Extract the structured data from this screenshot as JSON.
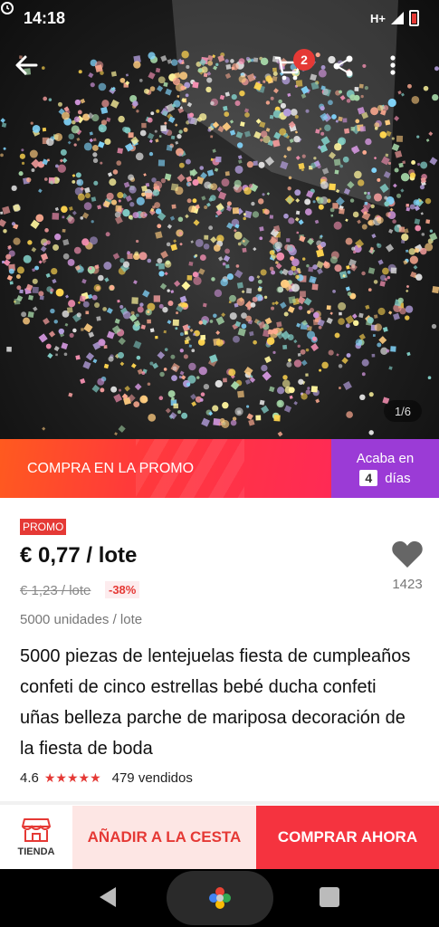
{
  "status_bar": {
    "time": "14:18",
    "network": "H+"
  },
  "hero": {
    "cart_count": "2",
    "image_index": "1/6"
  },
  "promo": {
    "label": "COMPRA EN LA PROMO",
    "ends_label": "Acaba en",
    "days": "4",
    "days_label": "días"
  },
  "product": {
    "promo_tag": "PROMO",
    "price": "€ 0,77 / lote",
    "original_price": "€ 1,23 / lote",
    "discount": "-38%",
    "unit_info": "5000 unidades / lote",
    "wishlist_count": "1423",
    "title": "5000 piezas de lentejuelas fiesta de cumpleaños confeti de cinco estrellas bebé ducha confeti uñas belleza parche de mariposa decoración de la fiesta de boda",
    "rating": "4.6",
    "stars": "★★★★★",
    "sold": "479 vendidos"
  },
  "actions": {
    "store_label": "TIENDA",
    "add_to_cart": "AÑADIR A LA CESTA",
    "buy_now": "COMPRAR AHORA"
  },
  "colors": {
    "accent": "#e53935",
    "promo_purple": "#9b3bd6",
    "buy_now": "#f5333f",
    "add_cart_bg": "#fde6e4"
  },
  "icons": [
    "back-arrow-icon",
    "cart-icon",
    "share-icon",
    "more-icon",
    "heart-icon",
    "store-icon",
    "nav-back-icon",
    "nav-home-icon",
    "nav-recent-icon"
  ]
}
